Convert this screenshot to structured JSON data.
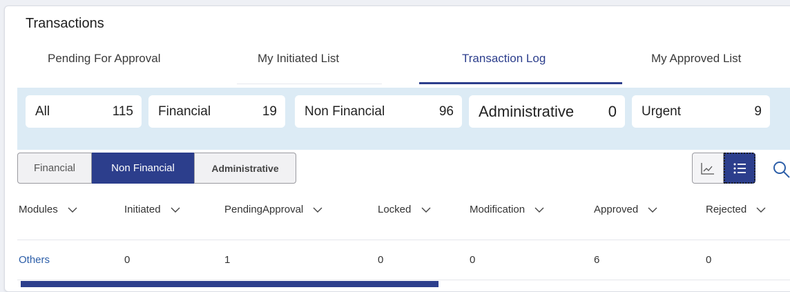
{
  "page": {
    "title": "Transactions"
  },
  "tabs": [
    {
      "label": "Pending For Approval"
    },
    {
      "label": "My Initiated List"
    },
    {
      "label": "Transaction Log"
    },
    {
      "label": "My Approved List"
    }
  ],
  "active_tab": "Transaction Log",
  "summary": [
    {
      "label": "All",
      "count": "115"
    },
    {
      "label": "Financial",
      "count": "19"
    },
    {
      "label": "Non Financial",
      "count": "96"
    },
    {
      "label": "Administrative",
      "count": "0"
    },
    {
      "label": "Urgent",
      "count": "9"
    }
  ],
  "segments": [
    {
      "label": "Financial"
    },
    {
      "label": "Non Financial"
    },
    {
      "label": "Administrative"
    }
  ],
  "active_segment": "Non Financial",
  "view_toggle": {
    "chart_icon": "line-chart-icon",
    "list_icon": "list-icon",
    "active": "list"
  },
  "search_icon": "search-icon",
  "table": {
    "columns": [
      "Modules",
      "Initiated",
      "PendingApproval",
      "Locked",
      "Modification",
      "Approved",
      "Rejected"
    ],
    "rows": [
      [
        "Others",
        "0",
        "1",
        "0",
        "0",
        "6",
        "0"
      ]
    ]
  },
  "colors": {
    "accent": "#2c3e8c",
    "summary_bg": "#dcebf5",
    "link": "#2c5ea8"
  }
}
